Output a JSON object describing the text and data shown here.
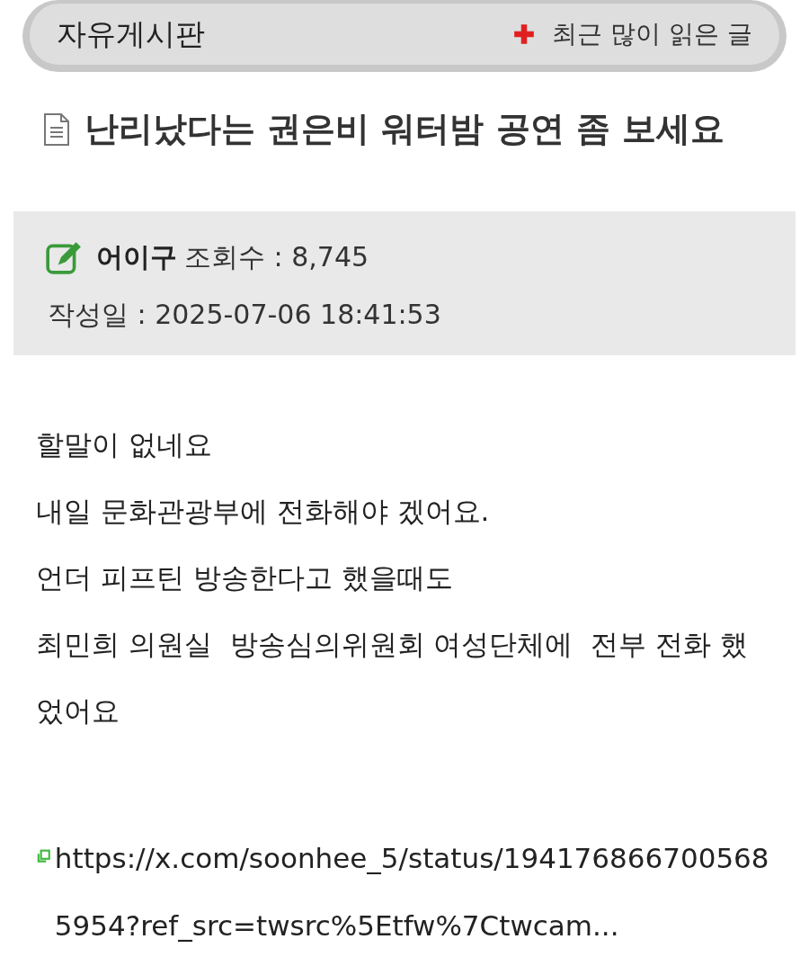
{
  "board": {
    "name": "자유게시판",
    "popular_link": "최근 많이 읽은 글"
  },
  "post": {
    "title": "난리났다는 권은비 워터밤 공연 좀 보세요",
    "author": "어이구",
    "views_label": "조회수 :",
    "views": "8,745",
    "date_label": "작성일 :",
    "date": "2025-07-06 18:41:53",
    "body": [
      "할말이 없네요",
      "내일 문화관광부에 전화해야 겠어요.",
      "언더 피프틴 방송한다고 했을때도",
      "최민희 의원실  방송심의위원회 여성단체에  전부 전화 했었어요"
    ],
    "link": "https://x.com/soonhee_5/status/1941768667005685954?ref_src=twsrc%5Etfw%7Ctwcam..."
  }
}
